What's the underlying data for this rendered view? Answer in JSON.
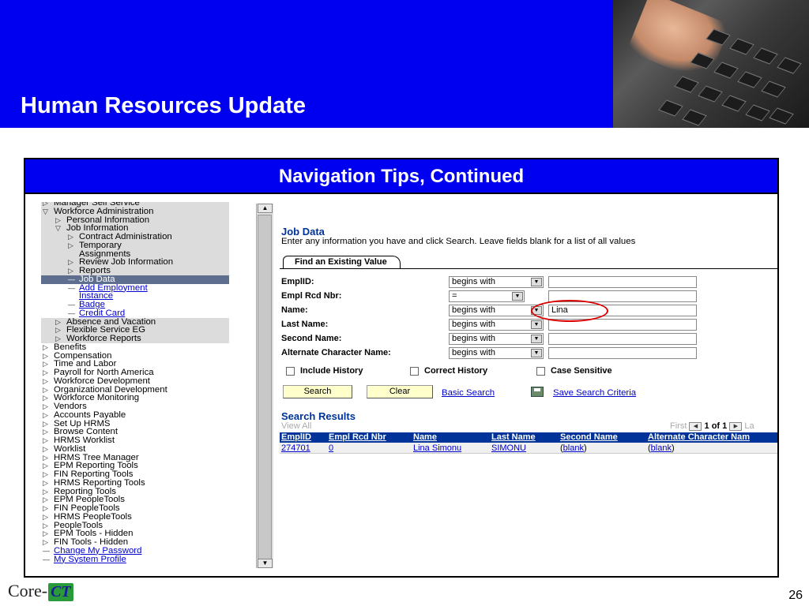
{
  "slide": {
    "title": "Human Resources Update",
    "frame_title": "Navigation Tips, Continued",
    "page_number": "26",
    "logo_text": "Core-",
    "logo_badge": "CT"
  },
  "nav": {
    "items": [
      {
        "text": "Manager Self Service",
        "glyph": "▷",
        "indent": 0
      },
      {
        "text": "Workforce Administration",
        "glyph": "▽",
        "indent": 0
      },
      {
        "text": "Personal Information",
        "glyph": "▷",
        "indent": 1
      },
      {
        "text": "Job Information",
        "glyph": "▽",
        "indent": 1
      },
      {
        "text": "Contract Administration",
        "glyph": "▷",
        "indent": 2
      },
      {
        "text": "Temporary",
        "glyph": "▷",
        "indent": 2
      },
      {
        "text": "Assignments",
        "glyph": "",
        "indent": 2
      },
      {
        "text": "Review Job Information",
        "glyph": "▷",
        "indent": 2
      },
      {
        "text": "Reports",
        "glyph": "▷",
        "indent": 2
      },
      {
        "text": "Job Data",
        "glyph": "—",
        "indent": 2
      },
      {
        "text": "Add Employment",
        "glyph": "—",
        "indent": 2
      },
      {
        "text": "Instance",
        "glyph": "",
        "indent": 2
      },
      {
        "text": "Badge",
        "glyph": "—",
        "indent": 2
      },
      {
        "text": "Credit Card",
        "glyph": "—",
        "indent": 2
      },
      {
        "text": "Absence and Vacation",
        "glyph": "▷",
        "indent": 1
      },
      {
        "text": "Flexible Service EG",
        "glyph": "▷",
        "indent": 1
      },
      {
        "text": "Workforce Reports",
        "glyph": "▷",
        "indent": 1
      },
      {
        "text": "Benefits",
        "glyph": "▷",
        "indent": 0
      },
      {
        "text": "Compensation",
        "glyph": "▷",
        "indent": 0
      },
      {
        "text": "Time and Labor",
        "glyph": "▷",
        "indent": 0
      },
      {
        "text": "Payroll for North America",
        "glyph": "▷",
        "indent": 0
      },
      {
        "text": "Workforce Development",
        "glyph": "▷",
        "indent": 0
      },
      {
        "text": "Organizational Development",
        "glyph": "▷",
        "indent": 0
      },
      {
        "text": "Workforce Monitoring",
        "glyph": "▷",
        "indent": 0
      },
      {
        "text": "Vendors",
        "glyph": "▷",
        "indent": 0
      },
      {
        "text": "Accounts Payable",
        "glyph": "▷",
        "indent": 0
      },
      {
        "text": "Set Up HRMS",
        "glyph": "▷",
        "indent": 0
      },
      {
        "text": "Browse Content",
        "glyph": "▷",
        "indent": 0
      },
      {
        "text": "HRMS Worklist",
        "glyph": "▷",
        "indent": 0
      },
      {
        "text": "Worklist",
        "glyph": "▷",
        "indent": 0
      },
      {
        "text": "HRMS Tree Manager",
        "glyph": "▷",
        "indent": 0
      },
      {
        "text": "EPM Reporting Tools",
        "glyph": "▷",
        "indent": 0
      },
      {
        "text": "FIN Reporting Tools",
        "glyph": "▷",
        "indent": 0
      },
      {
        "text": "HRMS Reporting Tools",
        "glyph": "▷",
        "indent": 0
      },
      {
        "text": "Reporting Tools",
        "glyph": "▷",
        "indent": 0
      },
      {
        "text": "EPM PeopleTools",
        "glyph": "▷",
        "indent": 0
      },
      {
        "text": "FIN PeopleTools",
        "glyph": "▷",
        "indent": 0
      },
      {
        "text": "HRMS PeopleTools",
        "glyph": "▷",
        "indent": 0
      },
      {
        "text": "PeopleTools",
        "glyph": "▷",
        "indent": 0
      },
      {
        "text": "EPM Tools - Hidden",
        "glyph": "▷",
        "indent": 0
      },
      {
        "text": "FIN Tools - Hidden",
        "glyph": "▷",
        "indent": 0
      },
      {
        "text": "Change My Password",
        "glyph": "—",
        "indent": 0
      },
      {
        "text": "My System Profile",
        "glyph": "—",
        "indent": 0
      }
    ]
  },
  "search": {
    "heading": "Job Data",
    "instructions": "Enter any information you have and click Search. Leave fields blank for a list of all values",
    "tab_label": "Find an Existing Value",
    "fields": [
      {
        "label": "EmplID:",
        "operator": "begins with",
        "value": ""
      },
      {
        "label": "Empl Rcd Nbr:",
        "operator": "=",
        "value": ""
      },
      {
        "label": "Name:",
        "operator": "begins with",
        "value": "Lina"
      },
      {
        "label": "Last Name:",
        "operator": "begins with",
        "value": ""
      },
      {
        "label": "Second Name:",
        "operator": "begins with",
        "value": ""
      },
      {
        "label": "Alternate Character Name:",
        "operator": "begins with",
        "value": ""
      }
    ],
    "checkboxes": [
      "Include History",
      "Correct History",
      "Case Sensitive"
    ],
    "search_button": "Search",
    "clear_button": "Clear",
    "basic_search_link": "Basic Search",
    "save_criteria_link": "Save Search Criteria"
  },
  "results": {
    "heading": "Search Results",
    "view_all": "View All",
    "pager": {
      "first": "First",
      "range": "1 of 1",
      "last": "La"
    },
    "columns": [
      "EmplID",
      "Empl Rcd Nbr",
      "Name",
      "Last Name",
      "Second Name",
      "Alternate Character Nam"
    ],
    "rows": [
      {
        "emplid": "274701",
        "rcd": "0",
        "name": "Lina Simonu",
        "last": "SIMONU",
        "second": "blank",
        "alt": "blank"
      }
    ]
  },
  "colors": {
    "banner": "#0000f0",
    "grid_header": "#003399",
    "nav_selected": "#5d6e8e",
    "highlight": "#dd0000",
    "button": "#ffffcc"
  }
}
